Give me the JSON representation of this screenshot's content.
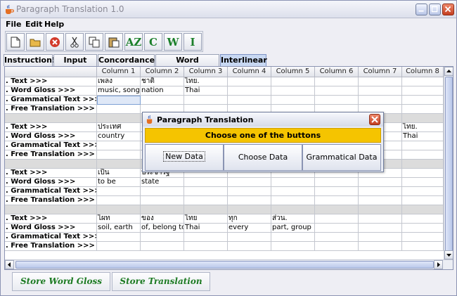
{
  "window": {
    "title": "Paragraph Translation 1.0"
  },
  "menu": [
    "File",
    "Edit",
    "Help"
  ],
  "toolbar": {
    "buttons": [
      {
        "name": "new-icon"
      },
      {
        "name": "open-folder-icon"
      },
      {
        "name": "stop-icon"
      },
      {
        "name": "cut-icon"
      },
      {
        "name": "copy-icon"
      },
      {
        "name": "paste-icon"
      },
      {
        "name": "sort-az-icon",
        "label": "AZ"
      },
      {
        "name": "c-icon",
        "label": "C"
      },
      {
        "name": "w-icon",
        "label": "W"
      },
      {
        "name": "i-icon",
        "label": "I"
      }
    ],
    "accent": "#1b7f2a"
  },
  "tabs": [
    "Instruction!",
    "Input Text",
    "Concordance",
    "Word Frequency",
    "Interlinear"
  ],
  "active_tab": "Interlinear",
  "table": {
    "columns": [
      "",
      "Column 1",
      "Column 2",
      "Column 3",
      "Column 4",
      "Column 5",
      "Column 6",
      "Column 7",
      "Column 8"
    ],
    "row_labels": [
      ". Text >>>",
      ". Word Gloss >>>",
      ". Grammatical Text >>>",
      ". Free Translation >>>"
    ],
    "blocks": [
      {
        "text": [
          "เพลง",
          "ชาติ",
          "ไทย.",
          "",
          "",
          "",
          "",
          ""
        ],
        "gloss": [
          "music, song",
          "nation",
          "Thai",
          "",
          "",
          "",
          "",
          ""
        ]
      },
      {
        "text": [
          "ประเทศ",
          "",
          "",
          "",
          "",
          "",
          "",
          "ไทย."
        ],
        "gloss": [
          "country",
          "",
          "",
          "",
          "",
          "",
          "",
          "Thai"
        ]
      },
      {
        "text": [
          "เป็น",
          "ประชารัฐ",
          "",
          "",
          "",
          "",
          "",
          ""
        ],
        "gloss": [
          "to be",
          "state",
          "",
          "",
          "",
          "",
          "",
          ""
        ]
      },
      {
        "text": [
          "ไผท",
          "ของ",
          "ไทย",
          "ทุก",
          "ส่วน.",
          "",
          "",
          ""
        ],
        "gloss": [
          "soil, earth",
          "of, belong to",
          "Thai",
          "every",
          "part, group",
          "",
          "",
          ""
        ]
      }
    ]
  },
  "bottom_buttons": [
    "Store Word Gloss",
    "Store Translation"
  ],
  "dialog": {
    "title": "Paragraph Translation",
    "prompt": "Choose one of the buttons",
    "buttons": [
      "New Data",
      "Choose Data",
      "Grammatical Data"
    ],
    "banner_color": "#f5c400"
  }
}
